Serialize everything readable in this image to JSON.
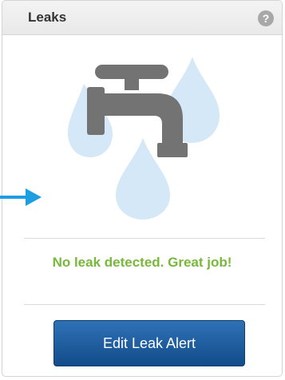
{
  "widget": {
    "title": "Leaks",
    "help_icon": "question-mark-icon",
    "help_glyph": "?"
  },
  "illustration": {
    "icon": "faucet-water-drops-icon",
    "faucet_color": "#737373",
    "drop_color": "#d5e8f7"
  },
  "status": {
    "message": "No leak detected. Great job!",
    "color": "#78b83b"
  },
  "actions": {
    "edit_label": "Edit Leak Alert"
  },
  "pointer": {
    "icon": "right-arrow-icon",
    "color": "#1e9ee2"
  }
}
